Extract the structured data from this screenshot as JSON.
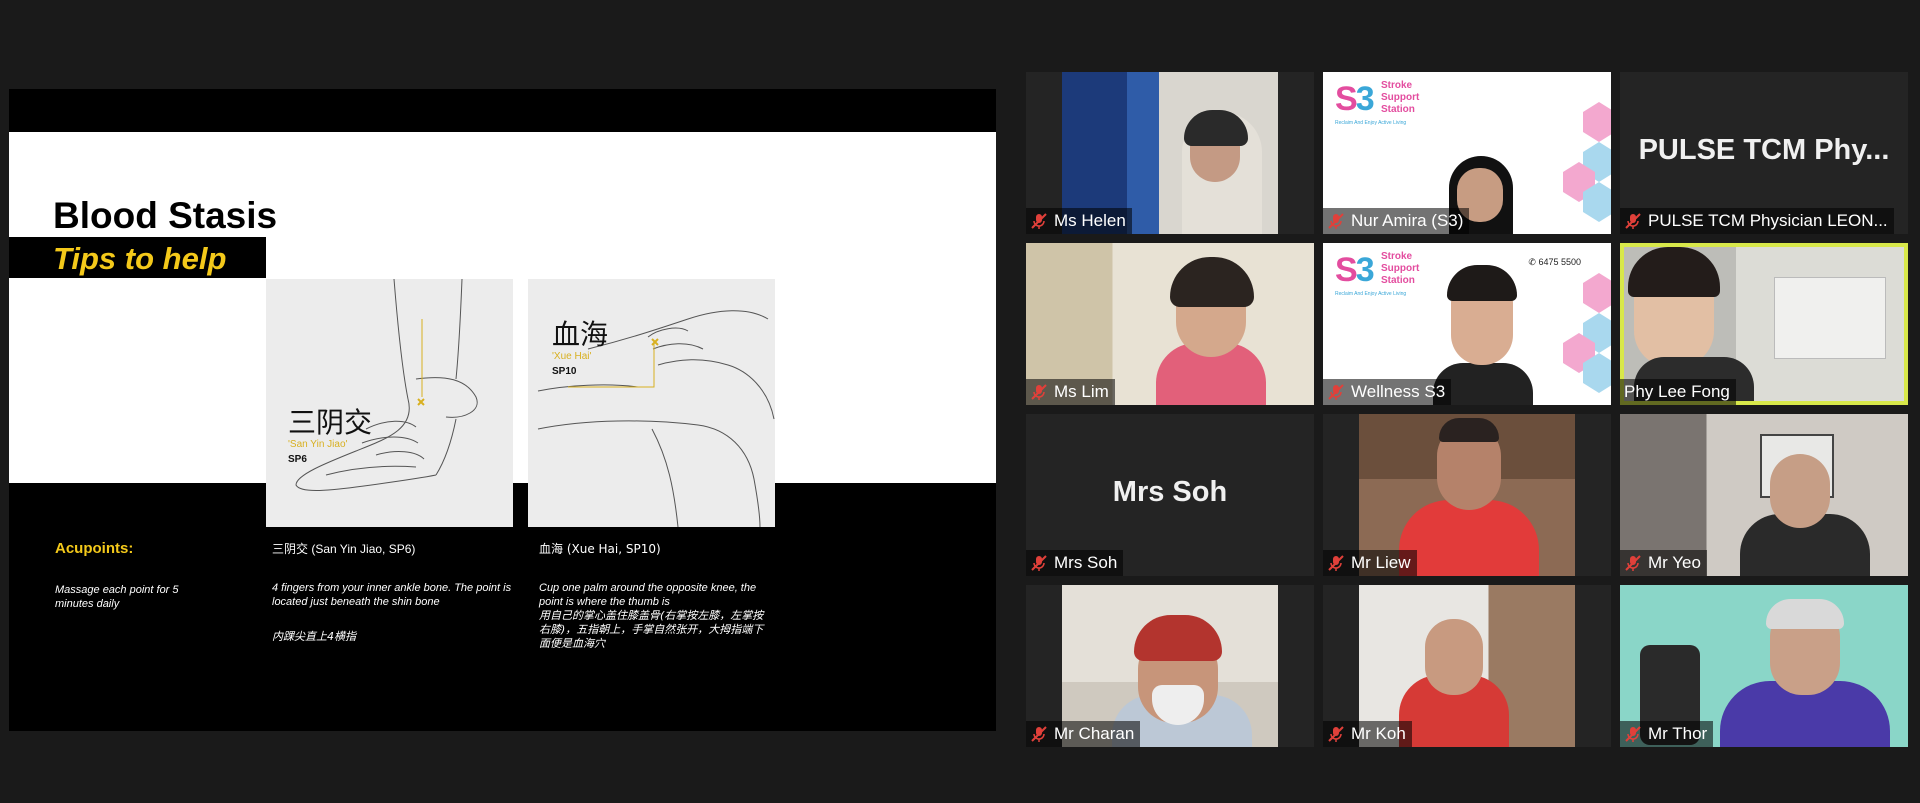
{
  "slide": {
    "title": "Blood Stasis",
    "subtitle": "Tips to help",
    "card1": {
      "cn": "三阴交",
      "pinyin": "'San Yin Jiao'",
      "code": "SP6"
    },
    "card2": {
      "cn": "血海",
      "pinyin": "'Xue Hai'",
      "code": "SP10"
    },
    "acupoints_heading": "Acupoints:",
    "acupoints_note": "Massage each point for 5 minutes daily",
    "col1_head": "三阴交 (San Yin Jiao, SP6)",
    "col1_body": "4 fingers from your inner ankle bone. The point is located just beneath the shin bone",
    "col1_cn": "内踝尖直上4横指",
    "col2_head": "血海 (Xue Hai, SP10)",
    "col2_body": "Cup one palm around the opposite knee, the point is where the thumb is",
    "col2_cn": "用自己的掌心盖住膝盖骨(右掌按左膝，左掌按右膝)，五指朝上，手掌自然张开，大拇指端下面便是血海穴"
  },
  "gallery": {
    "accent_color": "#d8e84a",
    "brand": {
      "logo": "S3",
      "name_lines": [
        "Stroke",
        "Support",
        "Station"
      ],
      "tagline": "Reclaim And Enjoy Active Living",
      "phone": "6475 5500"
    },
    "participants": [
      {
        "name": "Ms Helen",
        "muted": true,
        "icon": "mic-muted-icon"
      },
      {
        "name": "Nur Amira (S3)",
        "muted": true,
        "icon": "mic-muted-icon"
      },
      {
        "name": "PULSE TCM Physician LEON...",
        "big_label": "PULSE TCM Phy...",
        "muted": true,
        "icon": "mic-muted-icon"
      },
      {
        "name": "Ms Lim",
        "muted": true,
        "icon": "mic-muted-icon"
      },
      {
        "name": "Wellness S3",
        "muted": true,
        "icon": "mic-muted-icon"
      },
      {
        "name": "Phy Lee Fong",
        "muted": false,
        "active_speaker": true
      },
      {
        "name": "Mrs Soh",
        "big_label": "Mrs Soh",
        "muted": true,
        "icon": "mic-muted-icon"
      },
      {
        "name": "Mr Liew",
        "muted": true,
        "icon": "mic-muted-icon"
      },
      {
        "name": "Mr Yeo",
        "muted": true,
        "icon": "mic-muted-icon"
      },
      {
        "name": "Mr Charan",
        "muted": true,
        "icon": "mic-muted-icon"
      },
      {
        "name": "Mr Koh",
        "muted": true,
        "icon": "mic-muted-icon"
      },
      {
        "name": "Mr Thor",
        "muted": true,
        "icon": "mic-muted-icon"
      }
    ]
  }
}
